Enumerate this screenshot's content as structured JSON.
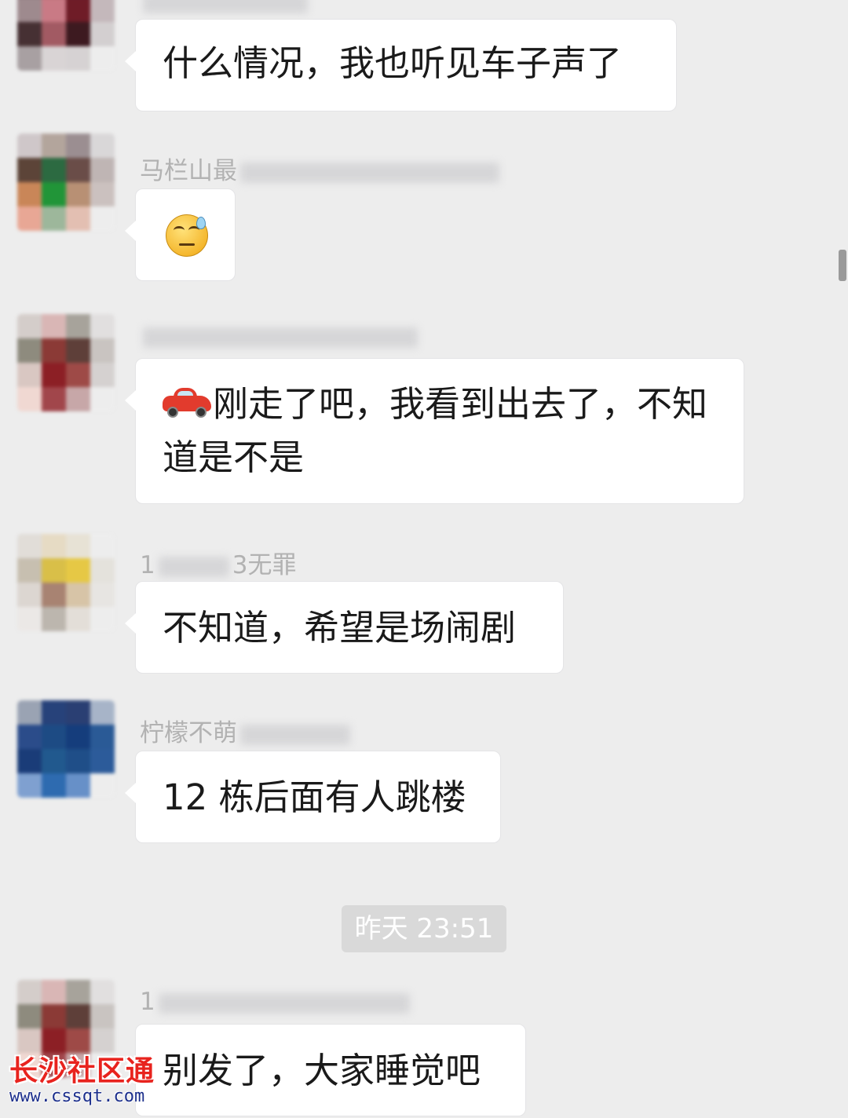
{
  "messages": [
    {
      "sender": "",
      "text": "什么情况，我也听见车子声了"
    },
    {
      "sender": "马栏山最",
      "emoji": "sweat-smile-emoji"
    },
    {
      "sender": "",
      "text_line1": "刚走了吧，我看到出去了，不知",
      "text_line2": "道是不是",
      "prefix_icon": "car-emoji"
    },
    {
      "sender_start": "1",
      "sender_end": "3无罪",
      "text": "不知道，希望是场闹剧"
    },
    {
      "sender": "柠檬不萌",
      "text": "12 栋后面有人跳楼"
    },
    {
      "sender": "1",
      "text": "别发了，大家睡觉吧"
    }
  ],
  "timestamp": "昨天 23:51",
  "watermark": {
    "title": "长沙社区通",
    "url": "www.cssqt.com"
  },
  "colors": {
    "background": "#ededed",
    "bubble": "#ffffff",
    "name": "#b2b2b2",
    "watermark_red": "#e8231e",
    "watermark_blue": "#1c2f8c"
  }
}
